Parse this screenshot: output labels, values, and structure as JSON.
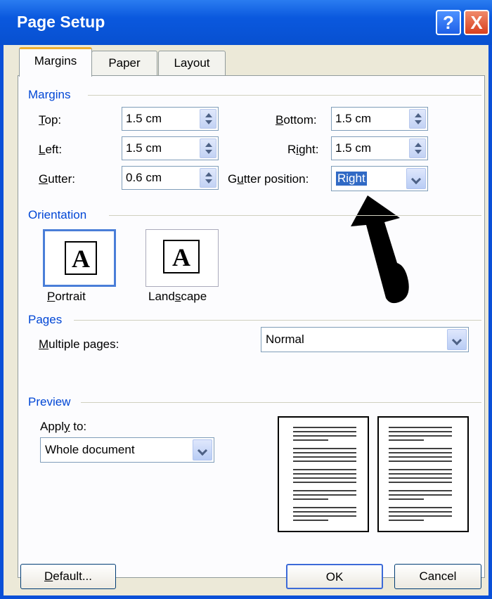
{
  "window": {
    "title": "Page Setup"
  },
  "title_buttons": {
    "help": "?",
    "close": "X"
  },
  "tabs": [
    {
      "label": "Margins"
    },
    {
      "label": "Paper"
    },
    {
      "label": "Layout"
    }
  ],
  "margins": {
    "heading": "Margins",
    "top": {
      "label": "Top:",
      "value": "1.5 cm"
    },
    "left": {
      "label": "Left:",
      "value": "1.5 cm"
    },
    "gutter": {
      "label": "Gutter:",
      "value": "0.6 cm"
    },
    "bottom": {
      "label": "Bottom:",
      "value": "1.5 cm"
    },
    "right": {
      "label": "Right:",
      "value": "1.5 cm"
    },
    "gutter_position": {
      "label": "Gutter position:",
      "value": "Right"
    }
  },
  "orientation": {
    "heading": "Orientation",
    "portrait": "Portrait",
    "landscape": "Landscape",
    "page_glyph": "A"
  },
  "pages": {
    "heading": "Pages",
    "multiple_label": "Multiple pages:",
    "multiple_value": "Normal"
  },
  "preview": {
    "heading": "Preview",
    "apply_label": "Apply to:",
    "apply_value": "Whole document"
  },
  "buttons": {
    "default": "Default...",
    "ok": "OK",
    "cancel": "Cancel"
  }
}
